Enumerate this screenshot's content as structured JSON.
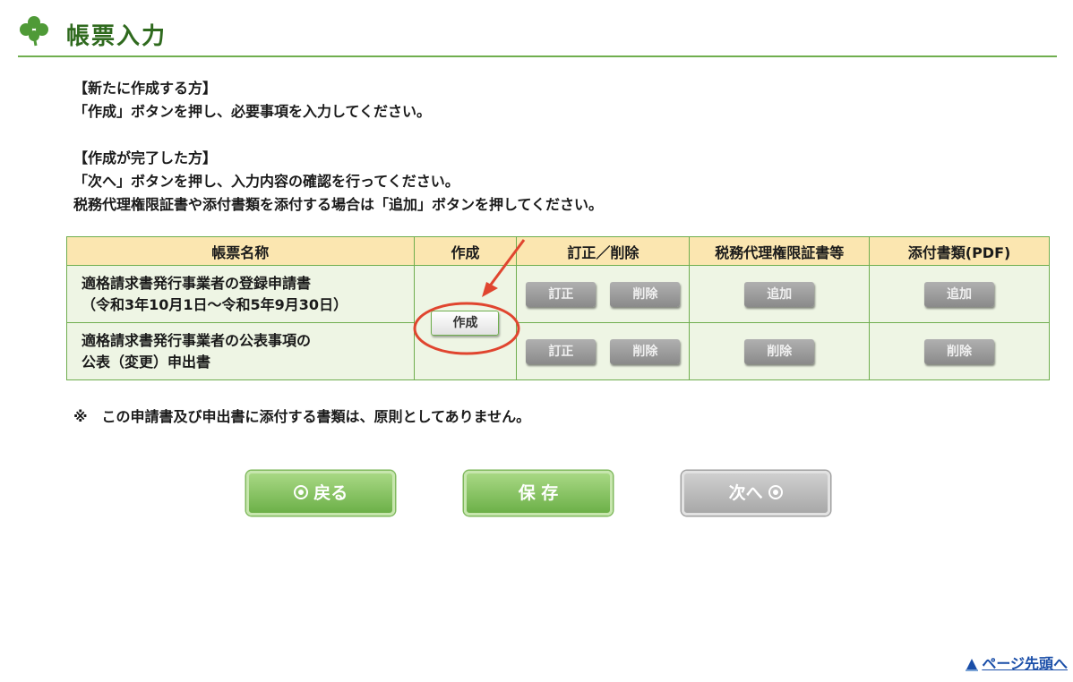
{
  "header": {
    "title": "帳票入力",
    "icon": "clover-icon"
  },
  "instructions": {
    "new_heading": "【新たに作成する方】",
    "new_text": "「作成」ボタンを押し、必要事項を入力してください。",
    "done_heading": "【作成が完了した方】",
    "done_text1": "「次へ」ボタンを押し、入力内容の確認を行ってください。",
    "done_text2": "税務代理権限証書や添付書類を添付する場合は「追加」ボタンを押してください。"
  },
  "table": {
    "headers": [
      "帳票名称",
      "作成",
      "訂正／削除",
      "税務代理権限証書等",
      "添付書類(PDF)"
    ],
    "rows": [
      {
        "name_line1": "適格請求書発行事業者の登録申請書",
        "name_line2": "（令和3年10月1日～令和5年9月30日）",
        "edit_label": "訂正",
        "delete_label": "削除",
        "proxy_label": "追加",
        "attachment_label": "追加"
      },
      {
        "name_line1": "適格請求書発行事業者の公表事項の",
        "name_line2": "公表（変更）申出書",
        "edit_label": "訂正",
        "delete_label": "削除",
        "proxy_label": "削除",
        "attachment_label": "削除"
      }
    ],
    "create_label": "作成"
  },
  "note": "※　この申請書及び申出書に添付する書類は、原則としてありません。",
  "nav": {
    "back_label": "戻る",
    "save_label": "保 存",
    "next_label": "次へ"
  },
  "page_top_link": "ページ先頭へ",
  "colors": {
    "accent_green": "#6fae4e",
    "title_green": "#2f6a1e",
    "header_bg": "#fbe6b0",
    "cell_bg": "#eef5e4",
    "annotation_red": "#e0452f"
  }
}
